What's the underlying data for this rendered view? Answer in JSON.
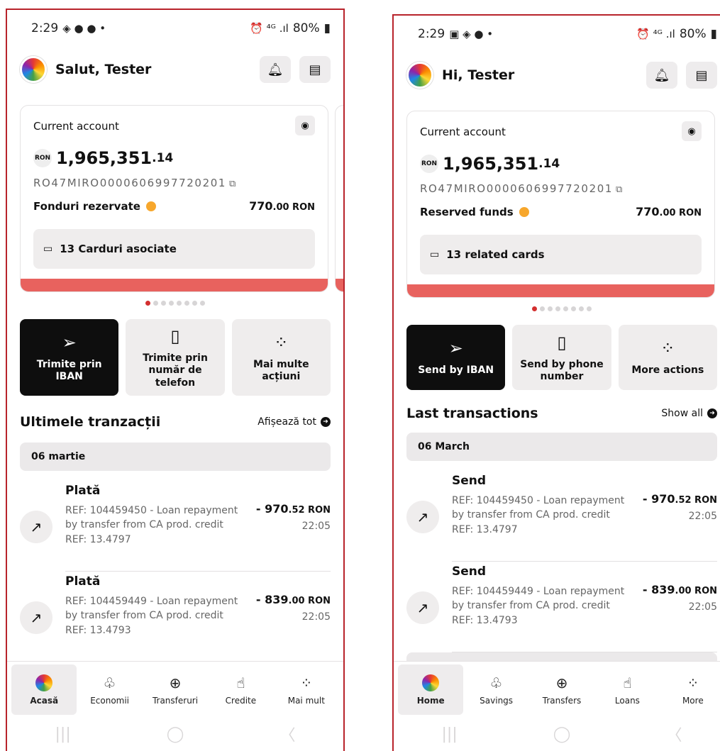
{
  "screens": [
    {
      "status": {
        "time": "2:29",
        "left_icons": "◈ ● ● •",
        "battery": "80%",
        "right_icons": "⏰ ⁴ᴳ .ıl"
      },
      "greeting": "Salut, Tester",
      "card": {
        "label": "Current account",
        "currency": "RON",
        "balance_main": "1,965,351",
        "balance_dec": ".14",
        "iban": "RO47MIRO0000606997720201",
        "funds_label": "Fonduri rezervate",
        "funds_main": "770",
        "funds_dec": ".00 RON",
        "cards_label": "13 Carduri asociate"
      },
      "actions": [
        "Trimite prin IBAN",
        "Trimite prin număr de telefon",
        "Mai multe acțiuni"
      ],
      "tx_title": "Ultimele tranzacții",
      "show_all": "Afișează tot",
      "date": "06 martie",
      "transactions": [
        {
          "name": "Plată",
          "desc": "REF: 104459450 - Loan repayment by transfer from CA prod. credit REF: 13.4797",
          "amount_main": "- 970",
          "amount_dec": ".52 RON",
          "time": "22:05"
        },
        {
          "name": "Plată",
          "desc": "REF: 104459449 - Loan repayment by transfer from CA prod. credit REF: 13.4793",
          "amount_main": "- 839",
          "amount_dec": ".00 RON",
          "time": "22:05"
        }
      ],
      "nav": [
        "Acasă",
        "Economii",
        "Transferuri",
        "Credite",
        "Mai mult"
      ]
    },
    {
      "status": {
        "time": "2:29",
        "left_icons": "▣ ◈ ● •",
        "battery": "80%",
        "right_icons": "⏰ ⁴ᴳ .ıl"
      },
      "greeting": "Hi, Tester",
      "card": {
        "label": "Current account",
        "currency": "RON",
        "balance_main": "1,965,351",
        "balance_dec": ".14",
        "iban": "RO47MIRO0000606997720201",
        "funds_label": "Reserved funds",
        "funds_main": "770",
        "funds_dec": ".00 RON",
        "cards_label": "13 related cards"
      },
      "actions": [
        "Send by IBAN",
        "Send by phone number",
        "More actions"
      ],
      "tx_title": "Last transactions",
      "show_all": "Show all",
      "date": "06 March",
      "transactions": [
        {
          "name": "Send",
          "desc": "REF: 104459450 - Loan repayment by transfer from CA prod. credit REF: 13.4797",
          "amount_main": "- 970",
          "amount_dec": ".52 RON",
          "time": "22:05"
        },
        {
          "name": "Send",
          "desc": "REF: 104459449 - Loan repayment by transfer from CA prod. credit REF: 13.4793",
          "amount_main": "- 839",
          "amount_dec": ".00 RON",
          "time": "22:05"
        }
      ],
      "nav": [
        "Home",
        "Savings",
        "Transfers",
        "Loans",
        "More"
      ]
    }
  ],
  "icons": {
    "bell": "bell-icon",
    "card": "card-wallet-icon",
    "eye": "eye-icon",
    "copy": "copy-icon",
    "send": "paper-plane-icon",
    "phone": "phone-icon",
    "more": "dots-grid-icon",
    "arrow": "arrow-up-right-icon",
    "savings": "piggy-bank-icon",
    "transfer": "plus-circle-icon",
    "loans": "hand-money-icon"
  },
  "colors": {
    "accent_red": "#e8625e",
    "dark_button": "#0e0e0e",
    "frame": "#b8232b",
    "info_orange": "#f7a72c"
  }
}
